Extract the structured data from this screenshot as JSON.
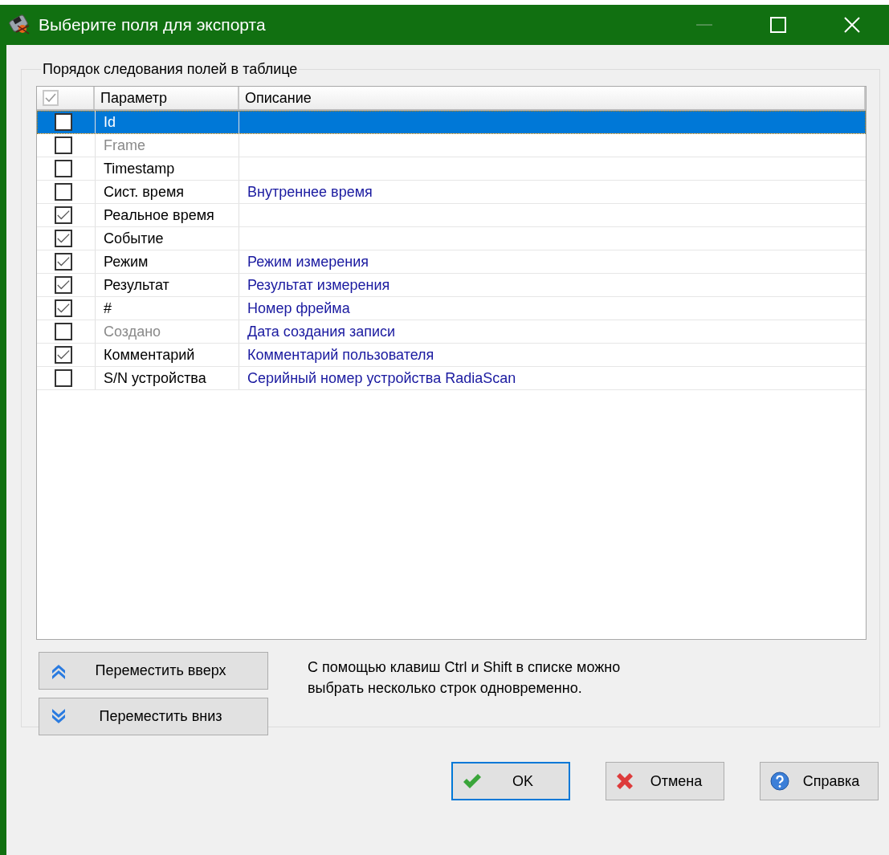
{
  "window": {
    "title": "Выберите поля для экспорта",
    "minimize_disabled": true
  },
  "group": {
    "title": "Порядок следования полей в таблице"
  },
  "table": {
    "header_checkbox": {
      "checked": true,
      "disabled": true
    },
    "columns": [
      "Параметр",
      "Описание"
    ],
    "rows": [
      {
        "name": "Id",
        "description": "",
        "checked": false,
        "disabled": false,
        "selected": true
      },
      {
        "name": "Frame",
        "description": "",
        "checked": false,
        "disabled": true,
        "selected": false
      },
      {
        "name": "Timestamp",
        "description": "",
        "checked": false,
        "disabled": false,
        "selected": false
      },
      {
        "name": "Сист. время",
        "description": "Внутреннее время",
        "checked": false,
        "disabled": false,
        "selected": false
      },
      {
        "name": "Реальное время",
        "description": "",
        "checked": true,
        "disabled": false,
        "selected": false
      },
      {
        "name": "Событие",
        "description": "",
        "checked": true,
        "disabled": false,
        "selected": false
      },
      {
        "name": "Режим",
        "description": "Режим измерения",
        "checked": true,
        "disabled": false,
        "selected": false
      },
      {
        "name": "Результат",
        "description": "Результат измерения",
        "checked": true,
        "disabled": false,
        "selected": false
      },
      {
        "name": "#",
        "description": "Номер фрейма",
        "checked": true,
        "disabled": false,
        "selected": false
      },
      {
        "name": "Создано",
        "description": "Дата создания записи",
        "checked": false,
        "disabled": true,
        "selected": false
      },
      {
        "name": "Комментарий",
        "description": "Комментарий пользователя",
        "checked": true,
        "disabled": false,
        "selected": false
      },
      {
        "name": "S/N устройства",
        "description": "Серийный номер устройства RadiaScan",
        "checked": false,
        "disabled": false,
        "selected": false
      }
    ]
  },
  "move_buttons": [
    {
      "kind": "up",
      "label": "Переместить вверх"
    },
    {
      "kind": "down",
      "label": "Переместить вниз"
    }
  ],
  "hint": "С помощью клавиш Ctrl и Shift в списке можно выбрать несколько строк одновременно.",
  "buttons": [
    {
      "kind": "ok",
      "label": "OK",
      "focused": true
    },
    {
      "kind": "cancel",
      "label": "Отмена",
      "focused": false
    },
    {
      "kind": "help",
      "label": "Справка",
      "focused": false
    }
  ]
}
